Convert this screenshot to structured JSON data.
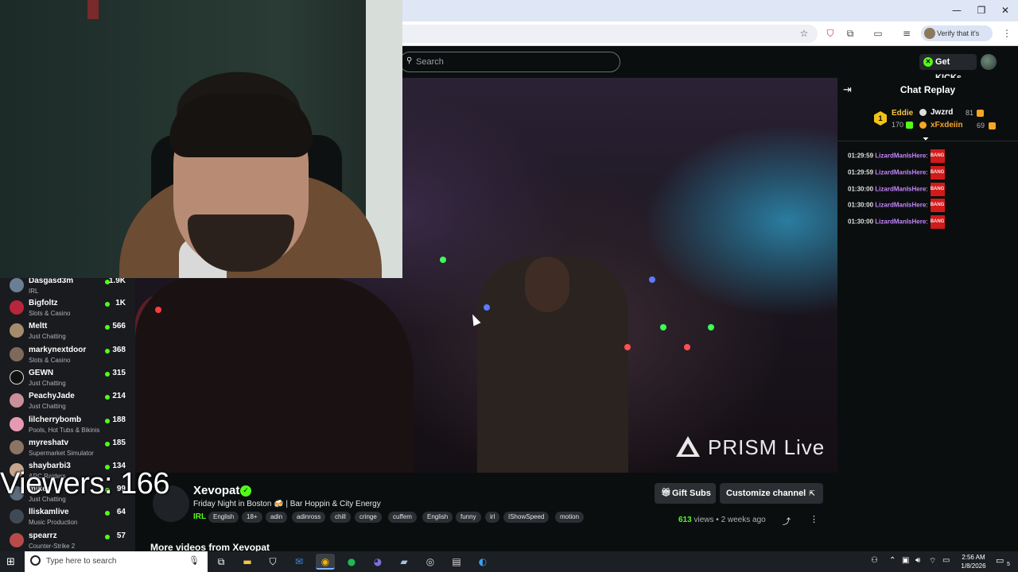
{
  "browser": {
    "window_controls": {
      "minimize": "—",
      "restore": "❐",
      "close": "✕"
    },
    "toolbar_icons": [
      "star-icon",
      "shield-extension-icon",
      "puzzle-extensions-icon",
      "cast-icon",
      "media-controls-icon"
    ],
    "verify_label": "Verify that it's you"
  },
  "header": {
    "search_placeholder": "Search",
    "get_kicks_label": "Get KICKs",
    "accent": "#53fc18"
  },
  "overlay": {
    "viewers_text": "Viewers: 166"
  },
  "sidebar": {
    "items": [
      {
        "name": "Dasgasd3m",
        "category": "IRL",
        "viewers": "1.9K"
      },
      {
        "name": "Bigfoltz",
        "category": "Slots & Casino",
        "viewers": "1K"
      },
      {
        "name": "Meltt",
        "category": "Just Chatting",
        "viewers": "566"
      },
      {
        "name": "markynextdoor",
        "category": "Slots & Casino",
        "viewers": "368"
      },
      {
        "name": "GEWN",
        "category": "Just Chatting",
        "viewers": "315"
      },
      {
        "name": "PeachyJade",
        "category": "Just Chatting",
        "viewers": "214"
      },
      {
        "name": "lilcherrybomb",
        "category": "Pools, Hot Tubs & Bikinis",
        "viewers": "188"
      },
      {
        "name": "myreshatv",
        "category": "Supermarket Simulator",
        "viewers": "185"
      },
      {
        "name": "shaybarbi3",
        "category": "ARC Raiders",
        "viewers": "134"
      },
      {
        "name": "mikeo",
        "category": "Just Chatting",
        "viewers": "99"
      },
      {
        "name": "lliskamlive",
        "category": "Music Production",
        "viewers": "64"
      },
      {
        "name": "spearrz",
        "category": "Counter-Strike 2",
        "viewers": "57"
      }
    ]
  },
  "video": {
    "watermark": "PRISM Live"
  },
  "chat": {
    "title": "Chat Replay",
    "leaderboard": [
      {
        "name": "Eddie",
        "count": "170",
        "rank": "1"
      },
      {
        "name": "Jwzrd",
        "count": "81"
      },
      {
        "name": "xFxdeiin",
        "count": "69"
      }
    ],
    "messages": [
      {
        "time": "01:29:59",
        "user": "LizardManIsHere",
        "colon": ":",
        "emote": "BANG"
      },
      {
        "time": "01:29:59",
        "user": "LizardManIsHere",
        "colon": ":",
        "emote": "BANG"
      },
      {
        "time": "01:30:00",
        "user": "LizardManIsHere",
        "colon": ":",
        "emote": "BANG"
      },
      {
        "time": "01:30:00",
        "user": "LizardManIsHere",
        "colon": ":",
        "emote": "BANG"
      },
      {
        "time": "01:30:00",
        "user": "LizardManIsHere",
        "colon": ":",
        "emote": "BANG"
      }
    ]
  },
  "stream": {
    "streamer": "Xevopat",
    "title": "Friday Night in Boston 🍻 | Bar Hoppin & City Energy",
    "category": "IRL",
    "tags": [
      "English",
      "18+",
      "adin",
      "adinross",
      "chill",
      "cringe",
      "cuffem",
      "English",
      "funny",
      "irl",
      "IShowSpeed",
      "motion"
    ],
    "gift_subs_label": "Gift Subs",
    "customize_label": "Customize channel",
    "views_count": "613",
    "views_word": "views",
    "separator": "•",
    "posted": "2 weeks ago",
    "more_videos": "More videos from Xevopat"
  },
  "taskbar": {
    "search_placeholder": "Type here to search",
    "time": "2:56 AM",
    "date": "1/8/2026",
    "notification_count": "5"
  }
}
